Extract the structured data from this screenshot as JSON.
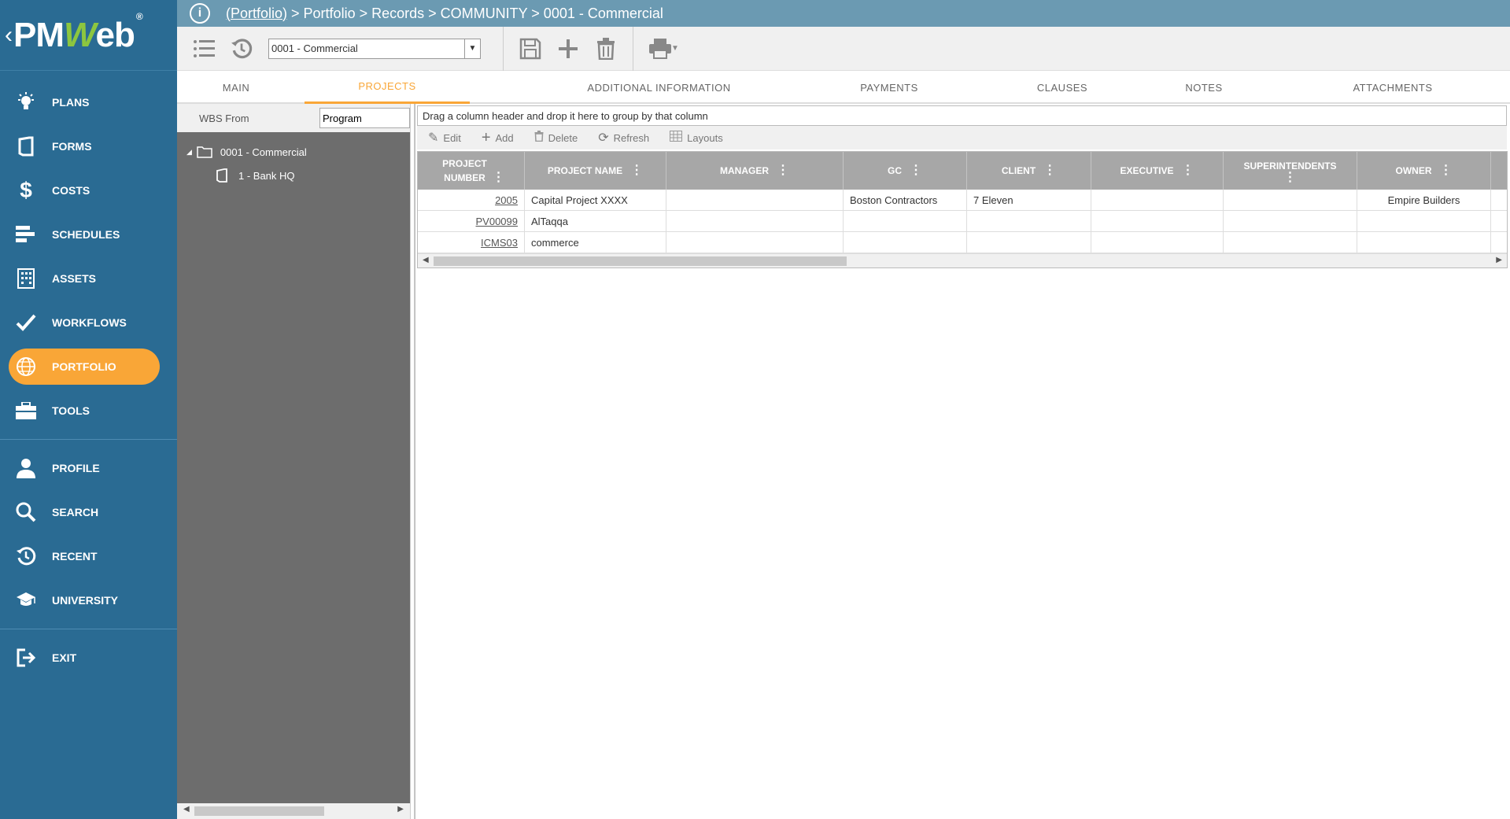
{
  "logo": {
    "text_a": "PM",
    "text_b": "W",
    "text_c": "eb",
    "reg": "®",
    "back": "‹"
  },
  "colors": {
    "sidebar": "#2a6b93",
    "accent": "#f9a637",
    "topbar": "#6b9ab2",
    "grid_header": "#a7a7a7"
  },
  "nav": {
    "items": [
      {
        "label": "PLANS",
        "icon": "lightbulb-icon"
      },
      {
        "label": "FORMS",
        "icon": "document-icon"
      },
      {
        "label": "COSTS",
        "icon": "dollar-icon"
      },
      {
        "label": "SCHEDULES",
        "icon": "schedule-bars-icon"
      },
      {
        "label": "ASSETS",
        "icon": "building-icon"
      },
      {
        "label": "WORKFLOWS",
        "icon": "checkmark-icon"
      },
      {
        "label": "PORTFOLIO",
        "icon": "globe-icon",
        "active": true
      },
      {
        "label": "TOOLS",
        "icon": "toolbox-icon"
      }
    ],
    "items2": [
      {
        "label": "PROFILE",
        "icon": "user-icon"
      },
      {
        "label": "SEARCH",
        "icon": "search-icon"
      },
      {
        "label": "RECENT",
        "icon": "history-icon"
      },
      {
        "label": "UNIVERSITY",
        "icon": "graduation-cap-icon"
      }
    ],
    "exit": {
      "label": "EXIT",
      "icon": "exit-icon"
    }
  },
  "breadcrumb": {
    "link": "(Portfolio)",
    "rest": " > Portfolio > Records > COMMUNITY > 0001 - Commercial"
  },
  "toolbar": {
    "record_select": "0001 - Commercial"
  },
  "tabs": [
    "MAIN",
    "PROJECTS",
    "ADDITIONAL INFORMATION",
    "PAYMENTS",
    "CLAUSES",
    "NOTES",
    "ATTACHMENTS"
  ],
  "tree": {
    "label": "WBS From",
    "input_value": "Program",
    "root": "0001 - Commercial",
    "child": "1 - Bank HQ"
  },
  "grid": {
    "group_hint": "Drag a column header and drop it here to group by that column",
    "tools": {
      "edit": "Edit",
      "add": "Add",
      "delete": "Delete",
      "refresh": "Refresh",
      "layouts": "Layouts"
    },
    "columns": [
      "PROJECT NUMBER",
      "PROJECT NAME",
      "MANAGER",
      "GC",
      "CLIENT",
      "EXECUTIVE",
      "SUPERINTENDENTS",
      "OWNER"
    ],
    "rows": [
      {
        "number": "2005",
        "name": "Capital Project XXXX",
        "manager": "",
        "gc": "Boston Contractors",
        "client": "7 Eleven",
        "executive": "",
        "superintendents": "",
        "owner": "Empire Builders"
      },
      {
        "number": "PV00099",
        "name": "AlTaqqa",
        "manager": "",
        "gc": "",
        "client": "",
        "executive": "",
        "superintendents": "",
        "owner": ""
      },
      {
        "number": "ICMS03",
        "name": "commerce",
        "manager": "",
        "gc": "",
        "client": "",
        "executive": "",
        "superintendents": "",
        "owner": ""
      }
    ]
  }
}
